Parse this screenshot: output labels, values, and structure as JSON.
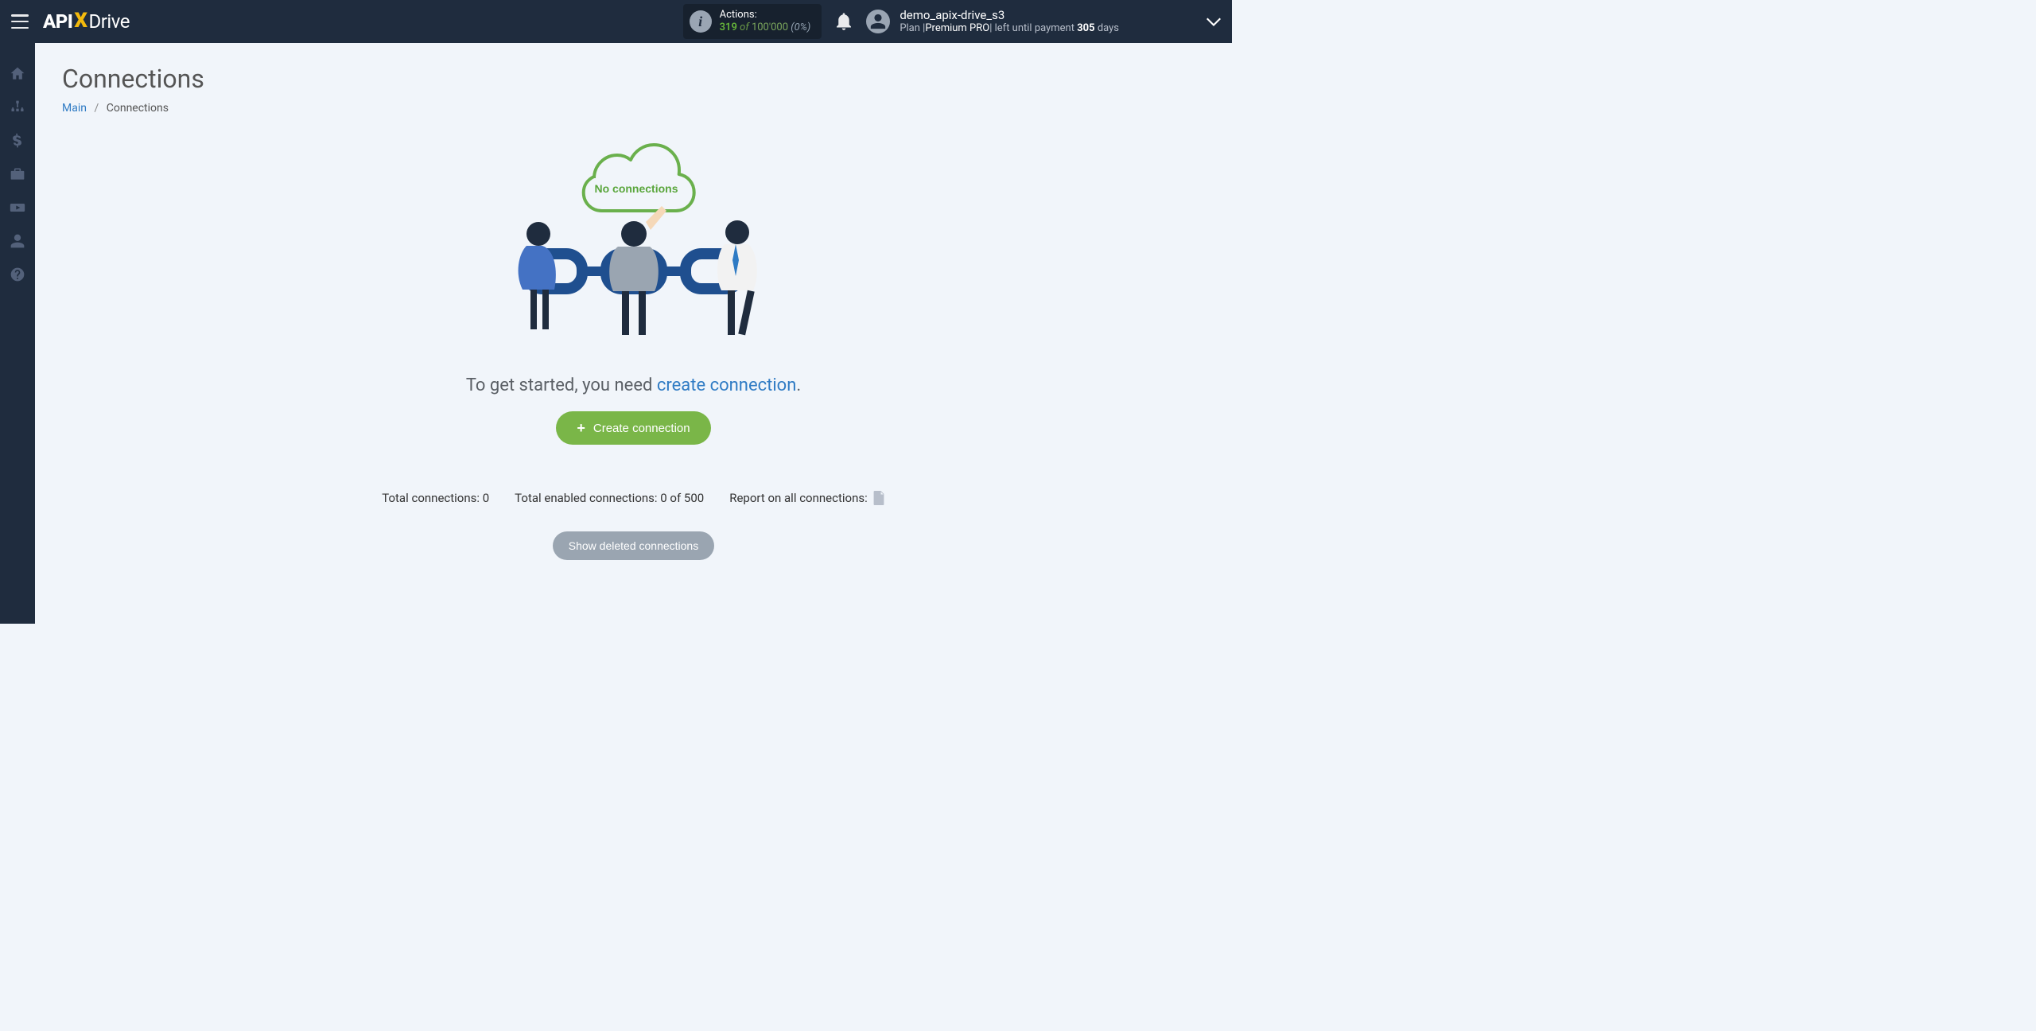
{
  "logo": {
    "part1": "API",
    "part2": "X",
    "part3": "Drive"
  },
  "actions_panel": {
    "label": "Actions:",
    "used": "319",
    "of": "of",
    "total": "100'000",
    "percent": "(0%)"
  },
  "user": {
    "name": "demo_apix-drive_s3",
    "plan_prefix": "Plan |",
    "plan_name": "Premium PRO",
    "plan_mid": "| left until payment ",
    "days": "305",
    "plan_suffix": " days"
  },
  "page": {
    "title": "Connections",
    "breadcrumb_main": "Main",
    "breadcrumb_sep": "/",
    "breadcrumb_current": "Connections"
  },
  "empty": {
    "cloud_text": "No connections",
    "prompt_prefix": "To get started, you need ",
    "prompt_link": "create connection",
    "prompt_suffix": ".",
    "create_button": "Create connection"
  },
  "stats": {
    "total_label": "Total connections: ",
    "total_value": "0",
    "enabled_label": "Total enabled connections: ",
    "enabled_value": "0 of 500",
    "report_label": "Report on all connections:"
  },
  "show_deleted": "Show deleted connections"
}
